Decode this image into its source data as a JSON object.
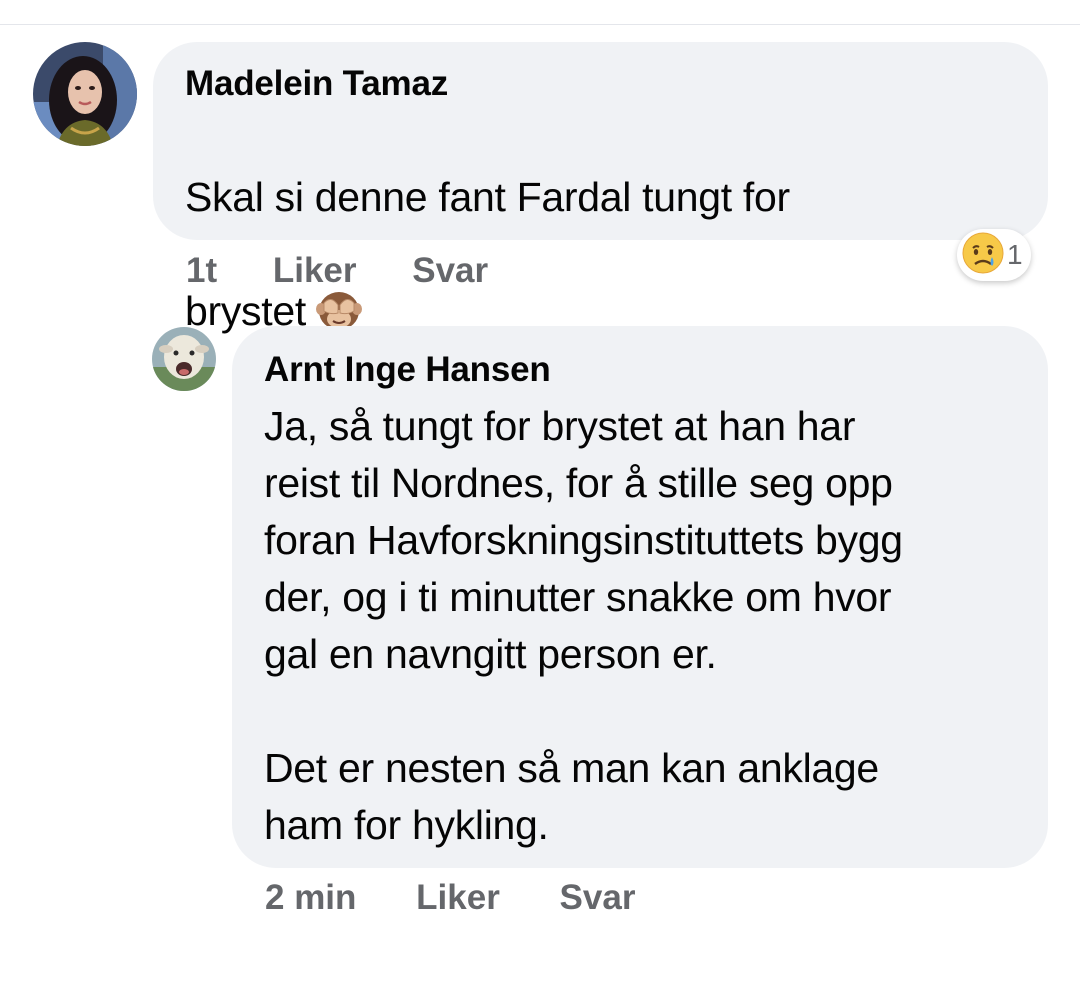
{
  "comments": [
    {
      "author": "Madelein Tamaz",
      "text": "Skal si denne fant Fardal tungt for\nbrystet",
      "inline_emoji": "see-no-evil-monkey",
      "time": "1t",
      "like_label": "Liker",
      "reply_label": "Svar",
      "reaction": {
        "icon": "sad-tear-face",
        "count": "1"
      }
    },
    {
      "author": "Arnt Inge Hansen",
      "text": "Ja, så tungt for brystet at han har\nreist til Nordnes, for å stille seg opp\nforan Havforskningsinstituttets bygg\nder, og i ti minutter snakke om hvor\ngal en navngitt person er.\n\nDet er nesten så man kan anklage\nham for hykling.",
      "time": "2 min",
      "like_label": "Liker",
      "reply_label": "Svar"
    }
  ],
  "colors": {
    "bubble": "#f0f2f5",
    "meta_text": "#65676b",
    "name_text": "#050505"
  }
}
